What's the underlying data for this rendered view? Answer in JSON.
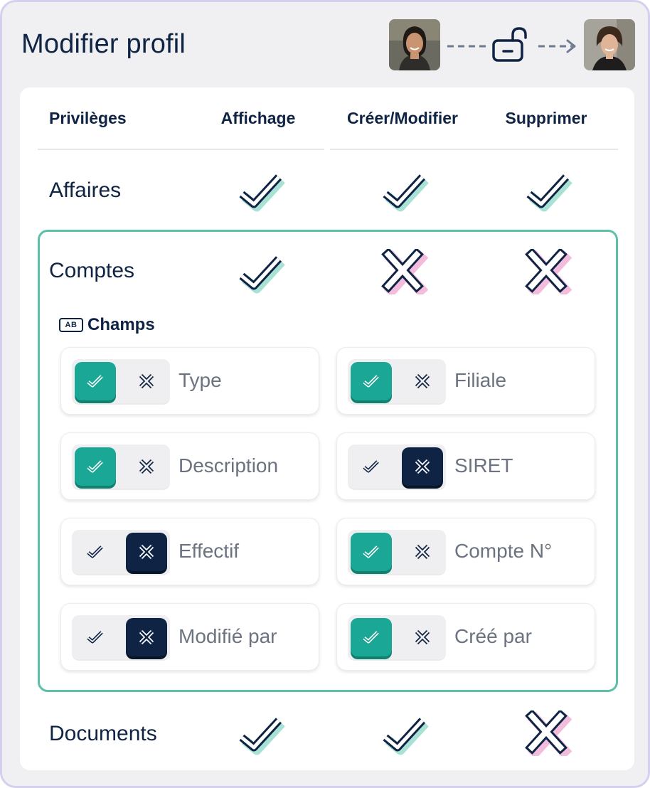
{
  "header": {
    "title": "Modifier profil",
    "from_avatar": "person-avatar",
    "lock_icon": "unlock-icon",
    "to_avatar": "person-avatar"
  },
  "table": {
    "columns": [
      "Privilèges",
      "Affichage",
      "Créer/Modifier",
      "Supprimer"
    ],
    "rows": [
      {
        "label": "Affaires",
        "affichage": true,
        "creer_modifier": true,
        "supprimer": true
      },
      {
        "label": "Comptes",
        "affichage": true,
        "creer_modifier": false,
        "supprimer": false
      },
      {
        "label": "Documents",
        "affichage": true,
        "creer_modifier": true,
        "supprimer": false
      }
    ]
  },
  "fields_section": {
    "title": "Champs",
    "icon": "ab-text-field-icon",
    "fields": [
      {
        "label": "Type",
        "allowed": true
      },
      {
        "label": "Filiale",
        "allowed": true
      },
      {
        "label": "Description",
        "allowed": true
      },
      {
        "label": "SIRET",
        "allowed": false
      },
      {
        "label": "Effectif",
        "allowed": false
      },
      {
        "label": "Compte N°",
        "allowed": true
      },
      {
        "label": "Modifié par",
        "allowed": false
      },
      {
        "label": "Créé par",
        "allowed": true
      }
    ]
  },
  "colors": {
    "navy": "#0f2444",
    "teal": "#1aa795",
    "check_shadow": "#a8e2d5",
    "cross_shadow": "#f4bcdc",
    "highlight_border": "#5dbfaa",
    "frame_border": "#d5d0f0"
  }
}
